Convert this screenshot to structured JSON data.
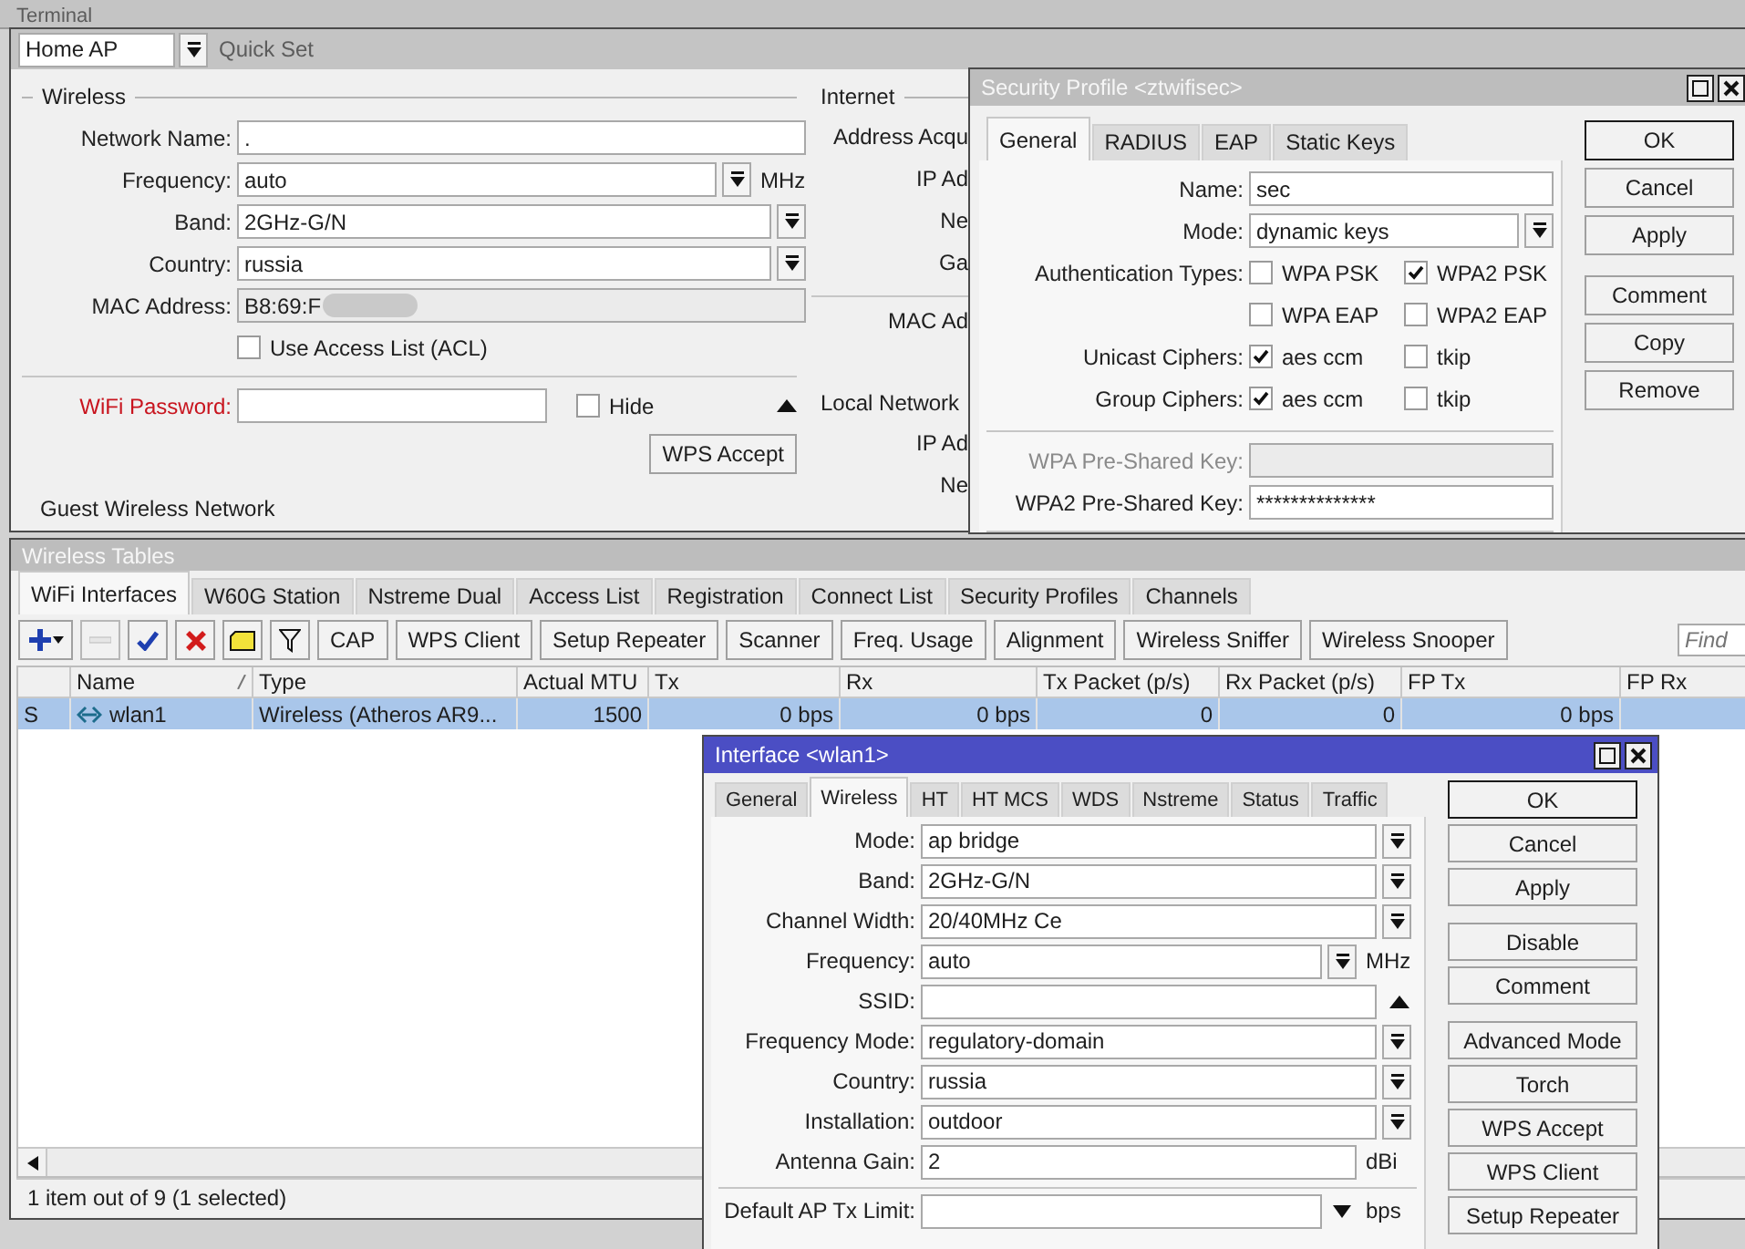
{
  "terminal": {
    "title": "Terminal"
  },
  "quick_set": {
    "mode": "Home AP",
    "title": "Quick Set",
    "wireless": {
      "heading": "Wireless",
      "fields": [
        {
          "label": "Network Name:",
          "value": ".",
          "kind": "text"
        },
        {
          "label": "Frequency:",
          "value": "auto",
          "kind": "dropdown",
          "unit": "MHz"
        },
        {
          "label": "Band:",
          "value": "2GHz-G/N",
          "kind": "dropdown"
        },
        {
          "label": "Country:",
          "value": "russia",
          "kind": "dropdown"
        },
        {
          "label": "MAC Address:",
          "value": "B8:69:F",
          "kind": "readonly",
          "redacted": true
        }
      ],
      "acl": {
        "label": "Use Access List (ACL)",
        "checked": false
      },
      "password": {
        "label": "WiFi Password:",
        "highlighted": true
      },
      "hide": {
        "label": "Hide",
        "checked": false
      },
      "wps_button": "WPS Accept"
    },
    "guest_heading": "Guest Wireless Network",
    "internet": {
      "heading": "Internet",
      "labels": [
        "Address Acqu",
        "IP Ad",
        "Ne",
        "Ga"
      ]
    },
    "mac_label": "MAC Ad",
    "local_network": {
      "heading": "Local Network",
      "labels": [
        "IP Ad",
        "Ne"
      ]
    }
  },
  "security_profile": {
    "title": "Security Profile <ztwifisec>",
    "active": false,
    "tabs": [
      {
        "label": "General",
        "selected": true
      },
      {
        "label": "RADIUS",
        "selected": false
      },
      {
        "label": "EAP",
        "selected": false
      },
      {
        "label": "Static Keys",
        "selected": false
      }
    ],
    "fields": [
      {
        "label": "Name:",
        "value": "sec",
        "kind": "text"
      },
      {
        "label": "Mode:",
        "value": "dynamic keys",
        "kind": "dropdown"
      },
      {
        "label": "Authentication Types:",
        "kind": "checks",
        "options": [
          {
            "label": "WPA PSK",
            "checked": false
          },
          {
            "label": "WPA2 PSK",
            "checked": true
          }
        ]
      },
      {
        "kind": "checks",
        "options": [
          {
            "label": "WPA EAP",
            "checked": false
          },
          {
            "label": "WPA2 EAP",
            "checked": false
          }
        ]
      },
      {
        "label": "Unicast Ciphers:",
        "kind": "checks",
        "options": [
          {
            "label": "aes ccm",
            "checked": true
          },
          {
            "label": "tkip",
            "checked": false
          }
        ]
      },
      {
        "label": "Group Ciphers:",
        "kind": "checks",
        "options": [
          {
            "label": "aes ccm",
            "checked": true
          },
          {
            "label": "tkip",
            "checked": false
          }
        ]
      }
    ],
    "keys": [
      {
        "label": "WPA Pre-Shared Key:",
        "kind": "text",
        "disabled": true
      },
      {
        "label": "WPA2 Pre-Shared Key:",
        "value": "**************",
        "kind": "text",
        "disabled": false
      }
    ],
    "buttons": [
      {
        "label": "OK",
        "default": true
      },
      {
        "label": "Cancel",
        "default": false
      },
      {
        "label": "Apply",
        "default": false
      },
      {
        "label": "Comment",
        "default": false
      },
      {
        "label": "Copy",
        "default": false
      },
      {
        "label": "Remove",
        "default": false
      }
    ]
  },
  "wireless_tables": {
    "title": "Wireless Tables",
    "tabs": [
      {
        "label": "WiFi Interfaces",
        "selected": true
      },
      {
        "label": "W60G Station",
        "selected": false
      },
      {
        "label": "Nstreme Dual",
        "selected": false
      },
      {
        "label": "Access List",
        "selected": false
      },
      {
        "label": "Registration",
        "selected": false
      },
      {
        "label": "Connect List",
        "selected": false
      },
      {
        "label": "Security Profiles",
        "selected": false
      },
      {
        "label": "Channels",
        "selected": false
      }
    ],
    "icon_buttons": [
      {
        "kind": "add",
        "disabled": false
      },
      {
        "kind": "remove",
        "disabled": true
      },
      {
        "kind": "enable",
        "disabled": false
      },
      {
        "kind": "disable",
        "disabled": false
      },
      {
        "kind": "comment",
        "disabled": false
      },
      {
        "kind": "filter",
        "disabled": false
      }
    ],
    "buttons": [
      "CAP",
      "WPS Client",
      "Setup Repeater",
      "Scanner",
      "Freq. Usage",
      "Alignment",
      "Wireless Sniffer",
      "Wireless Snooper"
    ],
    "find": {
      "placeholder": "Find"
    },
    "columns": [
      "Name",
      "Type",
      "Actual MTU",
      "Tx",
      "Rx",
      "Tx Packet (p/s)",
      "Rx Packet (p/s)",
      "FP Tx",
      "FP Rx"
    ],
    "rows": [
      {
        "flag": "S",
        "selected": true,
        "cells": [
          "wlan1",
          "Wireless (Atheros AR9...",
          "1500",
          "0 bps",
          "0 bps",
          "0",
          "0",
          "0 bps"
        ]
      }
    ],
    "status_bar": "1 item out of 9 (1 selected)"
  },
  "interface": {
    "title": "Interface <wlan1>",
    "active": true,
    "tabs": [
      {
        "label": "General",
        "selected": false
      },
      {
        "label": "Wireless",
        "selected": true
      },
      {
        "label": "HT",
        "selected": false
      },
      {
        "label": "HT MCS",
        "selected": false
      },
      {
        "label": "WDS",
        "selected": false
      },
      {
        "label": "Nstreme",
        "selected": false
      },
      {
        "label": "Status",
        "selected": false
      },
      {
        "label": "Traffic",
        "selected": false
      }
    ],
    "fields": [
      {
        "label": "Mode:",
        "value": "ap bridge",
        "kind": "dropdown"
      },
      {
        "label": "Band:",
        "value": "2GHz-G/N",
        "kind": "dropdown"
      },
      {
        "label": "Channel Width:",
        "value": "20/40MHz Ce",
        "kind": "dropdown"
      },
      {
        "label": "Frequency:",
        "value": "auto",
        "kind": "dropdown",
        "unit": "MHz"
      },
      {
        "label": "SSID:",
        "kind": "text",
        "collapsible": true
      },
      {
        "label": "Frequency Mode:",
        "value": "regulatory-domain",
        "kind": "dropdown"
      },
      {
        "label": "Country:",
        "value": "russia",
        "kind": "dropdown"
      },
      {
        "label": "Installation:",
        "value": "outdoor",
        "kind": "dropdown"
      },
      {
        "label": "Antenna Gain:",
        "value": "2",
        "kind": "text",
        "unit": "dBi"
      }
    ],
    "limits": [
      {
        "label": "Default AP Tx Limit:",
        "kind": "limit",
        "unit": "bps"
      }
    ],
    "buttons": [
      {
        "label": "OK",
        "default": true
      },
      {
        "label": "Cancel",
        "default": false
      },
      {
        "label": "Apply",
        "default": false
      },
      {
        "label": "Disable",
        "default": false
      },
      {
        "label": "Comment",
        "default": false
      },
      {
        "label": "Advanced Mode",
        "default": false
      },
      {
        "label": "Torch",
        "default": false
      },
      {
        "label": "WPS Accept",
        "default": false
      },
      {
        "label": "WPS Client",
        "default": false
      },
      {
        "label": "Setup Repeater",
        "default": false
      }
    ]
  }
}
